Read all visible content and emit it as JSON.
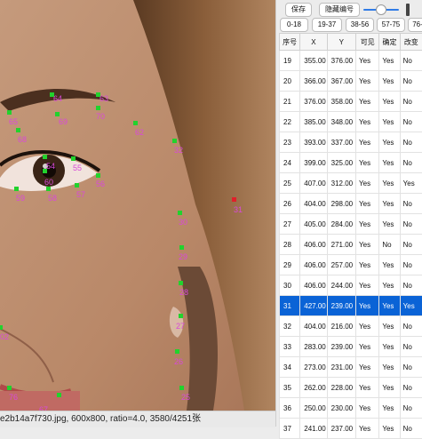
{
  "toolbar": {
    "save_label": "保存",
    "hide_ids_label": "隐藏编号",
    "slider_value": 0
  },
  "tabs": [
    {
      "label": "0-18"
    },
    {
      "label": "19-37"
    },
    {
      "label": "38-56"
    },
    {
      "label": "57-75"
    },
    {
      "label": "76-"
    }
  ],
  "table": {
    "headers": [
      "序号",
      "X",
      "Y",
      "可见",
      "确定",
      "改变"
    ],
    "rows": [
      {
        "id": "19",
        "x": "355.00",
        "y": "376.00",
        "vis": "Yes",
        "ok": "Yes",
        "chg": "No"
      },
      {
        "id": "20",
        "x": "366.00",
        "y": "367.00",
        "vis": "Yes",
        "ok": "Yes",
        "chg": "No"
      },
      {
        "id": "21",
        "x": "376.00",
        "y": "358.00",
        "vis": "Yes",
        "ok": "Yes",
        "chg": "No"
      },
      {
        "id": "22",
        "x": "385.00",
        "y": "348.00",
        "vis": "Yes",
        "ok": "Yes",
        "chg": "No"
      },
      {
        "id": "23",
        "x": "393.00",
        "y": "337.00",
        "vis": "Yes",
        "ok": "Yes",
        "chg": "No"
      },
      {
        "id": "24",
        "x": "399.00",
        "y": "325.00",
        "vis": "Yes",
        "ok": "Yes",
        "chg": "No"
      },
      {
        "id": "25",
        "x": "407.00",
        "y": "312.00",
        "vis": "Yes",
        "ok": "Yes",
        "chg": "Yes"
      },
      {
        "id": "26",
        "x": "404.00",
        "y": "298.00",
        "vis": "Yes",
        "ok": "Yes",
        "chg": "No"
      },
      {
        "id": "27",
        "x": "405.00",
        "y": "284.00",
        "vis": "Yes",
        "ok": "Yes",
        "chg": "No"
      },
      {
        "id": "28",
        "x": "406.00",
        "y": "271.00",
        "vis": "Yes",
        "ok": "No",
        "chg": "No"
      },
      {
        "id": "29",
        "x": "406.00",
        "y": "257.00",
        "vis": "Yes",
        "ok": "Yes",
        "chg": "No"
      },
      {
        "id": "30",
        "x": "406.00",
        "y": "244.00",
        "vis": "Yes",
        "ok": "Yes",
        "chg": "No"
      },
      {
        "id": "31",
        "x": "427.00",
        "y": "239.00",
        "vis": "Yes",
        "ok": "Yes",
        "chg": "Yes",
        "selected": true
      },
      {
        "id": "32",
        "x": "404.00",
        "y": "216.00",
        "vis": "Yes",
        "ok": "Yes",
        "chg": "No"
      },
      {
        "id": "33",
        "x": "283.00",
        "y": "239.00",
        "vis": "Yes",
        "ok": "Yes",
        "chg": "No"
      },
      {
        "id": "34",
        "x": "273.00",
        "y": "231.00",
        "vis": "Yes",
        "ok": "Yes",
        "chg": "No"
      },
      {
        "id": "35",
        "x": "262.00",
        "y": "228.00",
        "vis": "Yes",
        "ok": "Yes",
        "chg": "No"
      },
      {
        "id": "36",
        "x": "250.00",
        "y": "230.00",
        "vis": "Yes",
        "ok": "Yes",
        "chg": "No"
      },
      {
        "id": "37",
        "x": "241.00",
        "y": "237.00",
        "vis": "Yes",
        "ok": "Yes",
        "chg": "No"
      }
    ]
  },
  "landmarks": [
    {
      "label": "64"
    },
    {
      "label": "63"
    },
    {
      "label": "65"
    },
    {
      "label": "69"
    },
    {
      "label": "70"
    },
    {
      "label": "62"
    },
    {
      "label": "68"
    },
    {
      "label": "32"
    },
    {
      "label": "54"
    },
    {
      "label": "55"
    },
    {
      "label": "60"
    },
    {
      "label": "56"
    },
    {
      "label": "59"
    },
    {
      "label": "58"
    },
    {
      "label": "57"
    },
    {
      "label": "31"
    },
    {
      "label": "30"
    },
    {
      "label": "29"
    },
    {
      "label": "28"
    },
    {
      "label": "27"
    },
    {
      "label": "26"
    },
    {
      "label": "25"
    },
    {
      "label": "02"
    },
    {
      "label": "76"
    },
    {
      "label": "67"
    }
  ],
  "status": {
    "text": "e2b14a7f730.jpg, 600x800, ratio=4.0, 3580/4251张"
  },
  "colors": {
    "selection": "#0a63d6",
    "landmark_point": "#22d22d",
    "landmark_selected": "#e0202a",
    "landmark_label": "#d84ad8"
  }
}
